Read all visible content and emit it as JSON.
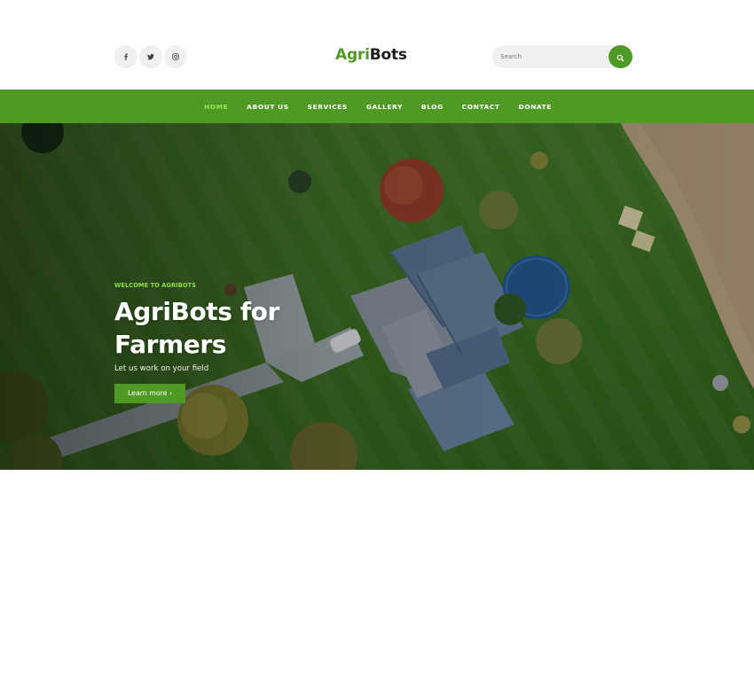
{
  "header": {
    "social_icons": [
      "facebook-icon",
      "twitter-icon",
      "instagram-icon"
    ],
    "social_glyphs": [
      "f",
      "",
      ""
    ],
    "logo": {
      "part1": "Agri",
      "part2": "Bots"
    },
    "search": {
      "placeholder": "Search",
      "value": "",
      "button_icon": "search-icon"
    }
  },
  "nav": {
    "items": [
      {
        "label": "HOME",
        "active": true
      },
      {
        "label": "ABOUT US",
        "active": false
      },
      {
        "label": "SERVICES",
        "active": false
      },
      {
        "label": "GALLERY",
        "active": false
      },
      {
        "label": "BLOG",
        "active": false
      },
      {
        "label": "CONTACT",
        "active": false
      },
      {
        "label": "DONATE",
        "active": false
      }
    ]
  },
  "hero": {
    "eyebrow": "WELCOME TO AGRIBOTS",
    "title_line1": "AgriBots for",
    "title_line2": "Farmers",
    "subtitle": "Let us work on your field",
    "button_label": "Learn more ›",
    "background": "aerial-farmhouse-photo"
  },
  "colors": {
    "brand_green": "#4f9a25",
    "nav_active": "#9be05a",
    "eyebrow": "#8ee04a",
    "social_bg": "#f0f0f0"
  }
}
